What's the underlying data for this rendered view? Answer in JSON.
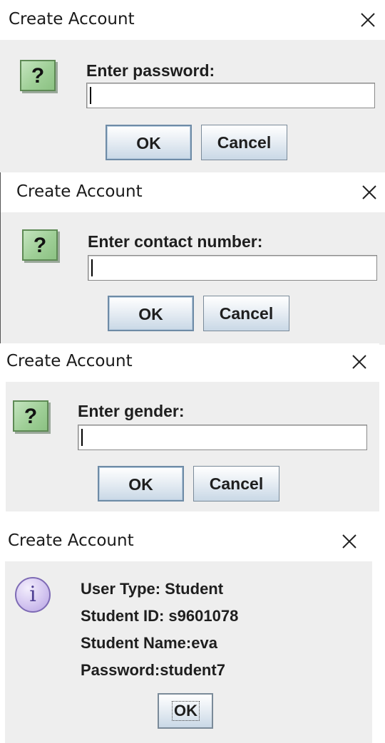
{
  "dialogs": [
    {
      "title": "Create Account",
      "prompt": "Enter password:",
      "input_value": "",
      "ok_label": "OK",
      "cancel_label": "Cancel"
    },
    {
      "title": "Create Account",
      "prompt": "Enter contact number:",
      "input_value": "",
      "ok_label": "OK",
      "cancel_label": "Cancel"
    },
    {
      "title": "Create Account",
      "prompt": "Enter gender:",
      "input_value": "",
      "ok_label": "OK",
      "cancel_label": "Cancel"
    }
  ],
  "info_dialog": {
    "title": "Create Account",
    "lines": [
      "User Type: Student",
      "Student ID: s9601078",
      "Student Name:eva",
      "Password:student7"
    ],
    "ok_label": "OK"
  },
  "icons": {
    "question": "question-icon",
    "information": "information-icon",
    "close": "close-icon"
  },
  "glyphs": {
    "question": "?",
    "information": "i"
  },
  "colors": {
    "dialog_bg": "#eeeeee",
    "titlebar_bg": "#ffffff",
    "question_icon": "#9fcf97",
    "info_icon": "#d3c5f0",
    "button_gradient_end": "#c9d8e6"
  }
}
